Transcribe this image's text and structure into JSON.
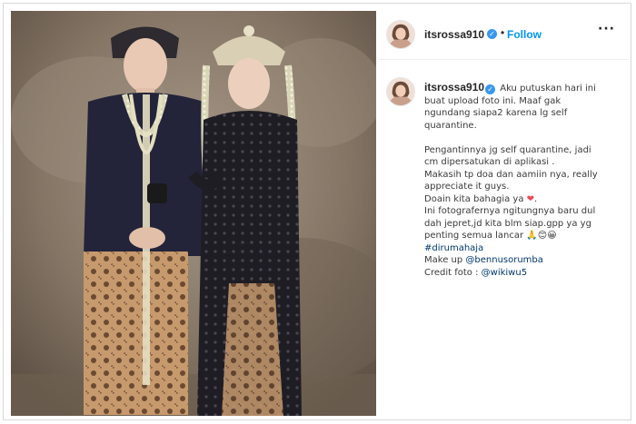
{
  "post": {
    "photo_alt": "",
    "header": {
      "username": "itsrossa910",
      "separator": "•",
      "follow_label": "Follow",
      "more_icon": "···"
    },
    "caption": {
      "username": "itsrossa910",
      "verified_icon": "✓",
      "line1": "Aku putuskan hari ini",
      "line2": "buat upload foto ini. Maaf gak",
      "line3": "ngundang siapa2 karena lg self",
      "line4": "quarantine.",
      "line5": "Pengantinnya jg self quarantine, jadi",
      "line6": "cm dipersatukan di aplikasi .",
      "line7": "Makasih tp doa dan aamiin nya, really",
      "line8": "appreciate it guys.",
      "line9": "Doain kita bahagia ya",
      "line9_heart": "❤",
      "line9_end": ".",
      "line10": "Ini fotografernya ngitungnya baru dul",
      "line11": "dah jepret,jd kita blm siap.gpp ya yg",
      "line12": "penting semua lancar",
      "line12_emojis": "🙏😊😀",
      "hashtag": "#dirumahaja",
      "makeup_label": "Make up ",
      "makeup_handle": "@bennusorumba",
      "credit_label": "Credit foto : ",
      "credit_handle": "@wikiwu5"
    }
  },
  "colors": {
    "follow_blue": "#0095f6",
    "verified_blue": "#3897f0",
    "link_blue": "#00376b",
    "heart_red": "#ed4956"
  }
}
